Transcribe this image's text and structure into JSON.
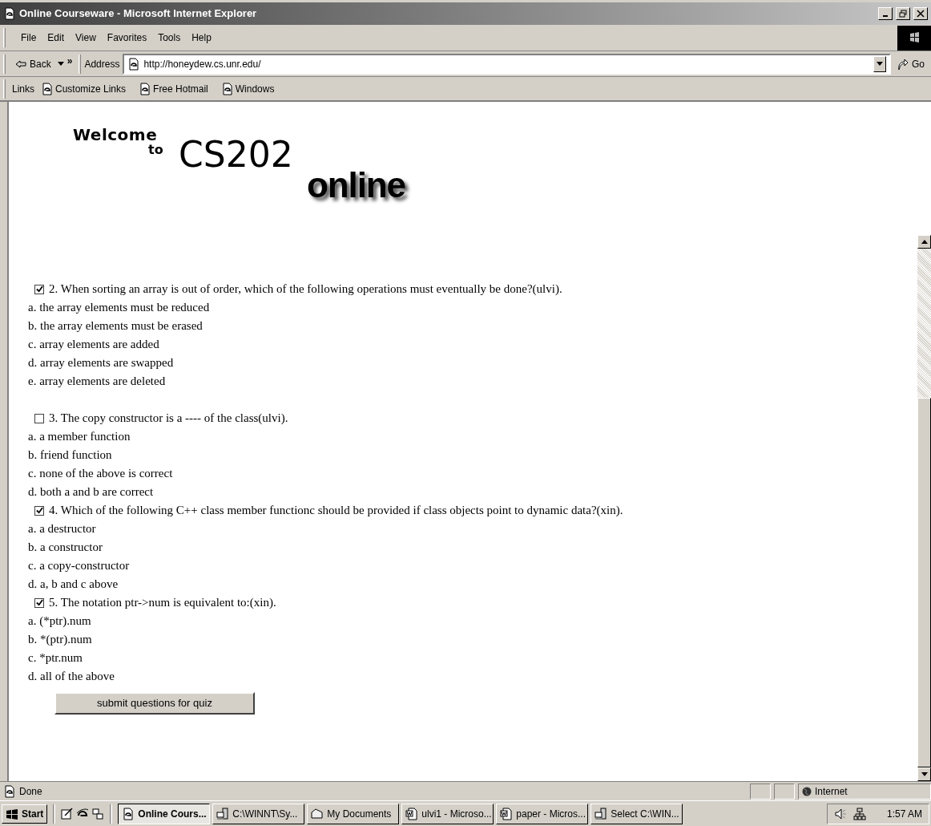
{
  "window": {
    "title": "Online Courseware - Microsoft Internet Explorer"
  },
  "menu": [
    "File",
    "Edit",
    "View",
    "Favorites",
    "Tools",
    "Help"
  ],
  "toolbar": {
    "back": "Back",
    "more": "»",
    "address_label": "Address",
    "url": "http://honeydew.cs.unr.edu/",
    "go": "Go"
  },
  "links_bar": {
    "label": "Links",
    "links": [
      "Customize Links",
      "Free Hotmail",
      "Windows"
    ]
  },
  "logo": {
    "welcome": "Welcome",
    "to": "to",
    "course": "CS202",
    "online": "online"
  },
  "questions": [
    {
      "checked": true,
      "text": "2. When sorting an array is out of order, which of the following operations must eventually be done?(ulvi).",
      "options": [
        "a. the array elements must be reduced",
        "b. the array elements must be erased",
        "c. array elements are added",
        "d. array elements are swapped",
        "e. array elements are deleted"
      ]
    },
    {
      "checked": false,
      "text": "3. The copy constructor is a ---- of the class(ulvi).",
      "options": [
        "a. a member function",
        "b. friend function",
        "c. none of the above is correct",
        "d. both a and b are correct"
      ]
    },
    {
      "checked": true,
      "text": "4. Which of the following C++ class member functionc should be provided if class objects point to dynamic data?(xin).",
      "options": [
        "a. a destructor",
        "b. a constructor",
        "c. a copy-constructor",
        "d. a, b and c above"
      ]
    },
    {
      "checked": true,
      "text": "5. The notation ptr->num is equivalent to:(xin).",
      "options": [
        "a. (*ptr).num",
        "b. *(ptr).num",
        "c. *ptr.num",
        "d. all of the above"
      ]
    }
  ],
  "submit_button": "submit questions for quiz",
  "status_bar": {
    "text": "Done",
    "zone": "Internet"
  },
  "taskbar": {
    "start": "Start",
    "tasks": [
      {
        "label": "Online Cours...",
        "selected": true,
        "kind": "ie"
      },
      {
        "label": "C:\\WINNT\\Sy...",
        "selected": false,
        "kind": "computer"
      },
      {
        "label": "My Documents",
        "selected": false,
        "kind": "folder"
      },
      {
        "label": "ulvi1 - Microso...",
        "selected": false,
        "kind": "word"
      },
      {
        "label": "paper - Micros...",
        "selected": false,
        "kind": "word"
      },
      {
        "label": "Select C:\\WIN...",
        "selected": false,
        "kind": "computer"
      }
    ],
    "clock": "1:57 AM"
  }
}
